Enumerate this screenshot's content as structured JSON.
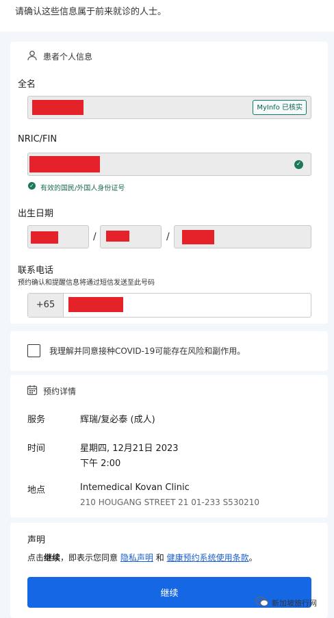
{
  "top_note": "请确认这些信息属于前来就诊的人士。",
  "personal": {
    "section_title": "患者个人信息",
    "full_name_label": "全名",
    "myinfo_badge": "MyInfo 已核实",
    "nric_label": "NRIC/FIN",
    "nric_valid_text": "有效的国民/外国人身份证号",
    "dob_label": "出生日期",
    "dob_sep1": "/",
    "dob_sep2": "/",
    "phone_label": "联系电话",
    "phone_hint": "预约确认和提醒信息将通过短信发送至此号码",
    "phone_prefix": "+65"
  },
  "consent": {
    "text": "我理解并同意接种COVID-19可能存在风险和副作用。"
  },
  "appointment": {
    "section_title": "预约详情",
    "service_key": "服务",
    "service_val": "辉瑞/复必泰 (成人)",
    "time_key": "时间",
    "time_line1": "星期四, 12月21日 2023",
    "time_line2": "下午 2:00",
    "location_key": "地点",
    "location_name": "Intemedical Kovan Clinic",
    "location_address": "210 HOUGANG STREET 21 01-233 S530210"
  },
  "declaration": {
    "title": "声明",
    "prefix": "点击",
    "bold": "继续",
    "middle": "，即表示您同意",
    "link1": "隐私声明",
    "and": "和",
    "link2": "健康预约系统使用条款",
    "end": "。",
    "button": "继续"
  },
  "watermark": "新加坡旅行网",
  "colors": {
    "primary": "#1667e4",
    "valid_green": "#1b7a55",
    "redaction": "#e5212a",
    "link": "#1a5fd0"
  }
}
